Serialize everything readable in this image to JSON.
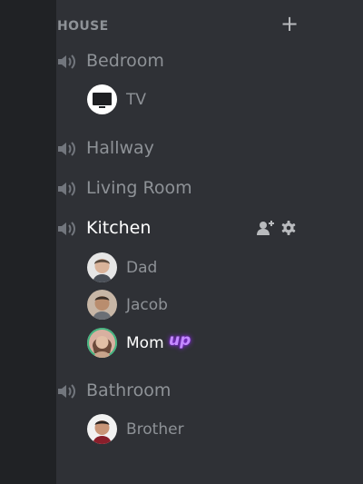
{
  "category": {
    "label": "HOUSE",
    "add_icon": "plus-icon"
  },
  "channels": [
    {
      "label": "Bedroom",
      "icon": "speaker-icon"
    },
    {
      "label": "Hallway",
      "icon": "speaker-icon"
    },
    {
      "label": "Living Room",
      "icon": "speaker-icon"
    },
    {
      "label": "Kitchen",
      "icon": "speaker-icon",
      "active": true
    },
    {
      "label": "Bathroom",
      "icon": "speaker-icon"
    }
  ],
  "members": {
    "bedroom": [
      {
        "name": "TV",
        "avatar": "tv-icon"
      }
    ],
    "kitchen": [
      {
        "name": "Dad",
        "avatar": "dad-avatar"
      },
      {
        "name": "Jacob",
        "avatar": "jacob-avatar"
      },
      {
        "name": "Mom",
        "avatar": "mom-avatar",
        "speaking": true,
        "badge": "up"
      }
    ],
    "bathroom": [
      {
        "name": "Brother",
        "avatar": "brother-avatar"
      }
    ]
  },
  "icons": {
    "kitchen_actions": [
      "add-member-icon",
      "gear-icon"
    ]
  },
  "colors": {
    "background": "#2f3136",
    "server_rail": "#202225",
    "muted_text": "#8e9297",
    "active_text": "#ffffff",
    "speaking_ring": "#43b581",
    "badge": "#c48bff"
  }
}
